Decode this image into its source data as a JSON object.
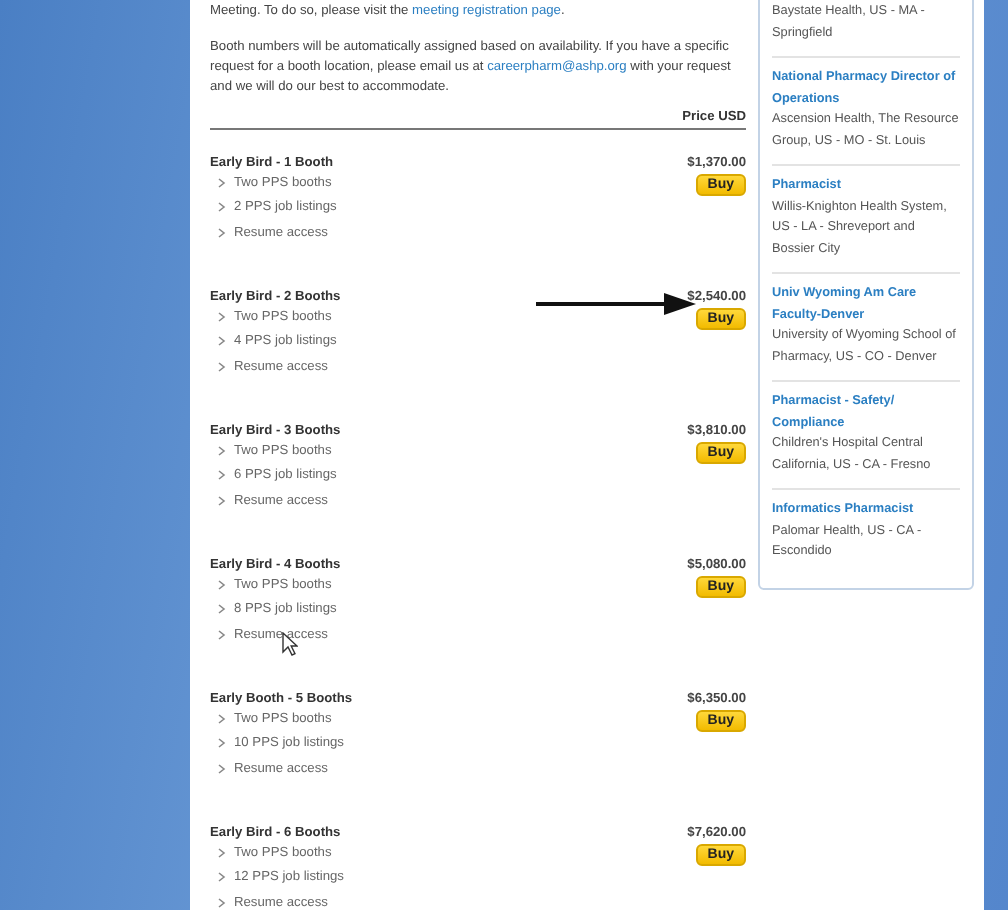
{
  "intro": [
    {
      "before": "Meeting. To do so, please visit the ",
      "link": "meeting registration page",
      "after": "."
    },
    {
      "before": "Booth numbers will be automatically assigned based on availability. If you have a specific request for a booth location, please email us at ",
      "link": "careerpharm@ashp.org",
      "after": " with your request and we will do our best to accommodate."
    }
  ],
  "price_header": "Price USD",
  "packages": [
    {
      "title": "Early Bird - 1 Booth",
      "price": "$1,370.00",
      "button": "Buy",
      "features": [
        "Two PPS booths",
        "2 PPS job listings",
        "Resume access"
      ]
    },
    {
      "title": "Early Bird - 2 Booths",
      "price": "$2,540.00",
      "button": "Buy",
      "features": [
        "Two PPS booths",
        "4 PPS job listings",
        "Resume access"
      ]
    },
    {
      "title": "Early Bird - 3 Booths",
      "price": "$3,810.00",
      "button": "Buy",
      "features": [
        "Two PPS booths",
        "6 PPS job listings",
        "Resume access"
      ]
    },
    {
      "title": "Early Bird - 4 Booths",
      "price": "$5,080.00",
      "button": "Buy",
      "features": [
        "Two PPS booths",
        "8 PPS job listings",
        "Resume access"
      ]
    },
    {
      "title": "Early Booth - 5 Booths",
      "price": "$6,350.00",
      "button": "Buy",
      "features": [
        "Two PPS booths",
        "10 PPS job listings",
        "Resume access"
      ]
    },
    {
      "title": "Early Bird - 6 Booths",
      "price": "$7,620.00",
      "button": "Buy",
      "features": [
        "Two PPS booths",
        "12 PPS job listings",
        "Resume access"
      ]
    }
  ],
  "sidebar": {
    "jobs": [
      {
        "detail": "Baystate Health, US - MA - Springfield"
      },
      {
        "title": "National Pharmacy Director of Operations",
        "detail": "Ascension Health, The Resource Group, US - MO - St. Louis"
      },
      {
        "title": "Pharmacist",
        "detail": "Willis-Knighton Health System, US - LA - Shreveport and Bossier City"
      },
      {
        "title": "Univ Wyoming Am Care Faculty-Denver",
        "detail": "University of Wyoming School of Pharmacy, US - CO - Denver"
      },
      {
        "title": "Pharmacist - Safety/ Compliance",
        "detail": "Children's Hospital Central California, US - CA - Fresno"
      },
      {
        "title": "Informatics Pharmacist",
        "detail": "Palomar Health, US - CA - Escondido"
      }
    ]
  }
}
